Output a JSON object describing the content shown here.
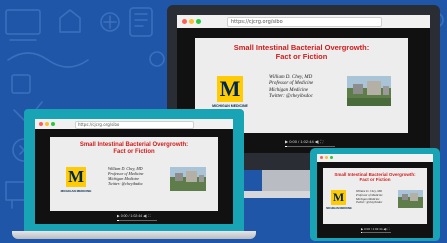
{
  "browser": {
    "url": "https://cjcrg.org/sibo",
    "control_glyphs": {
      "play": "▶",
      "volume": "◀)",
      "fullscreen": "⛶"
    }
  },
  "slide": {
    "title_line1": "Small Intestinal Bacterial Overgrowth:",
    "title_line2": "Fact or Fiction",
    "logo_letter": "M",
    "logo_text": "MICHIGAN MEDICINE",
    "author_line1": "William D. Chey, MD",
    "author_line2": "Professor of Medicine",
    "author_line3": "Michigan Medicine",
    "author_line4": "Twitter: @cheyibsdoc"
  },
  "player": {
    "time": "0:00 / 1:02:44",
    "progress_fraction": 0.04
  },
  "colors": {
    "background": "#1f56a8",
    "teal_bezel": "#18a4b4",
    "slide_title": "#d01c1c",
    "michigan_maize": "#ffcb05",
    "michigan_blue": "#00274c"
  }
}
